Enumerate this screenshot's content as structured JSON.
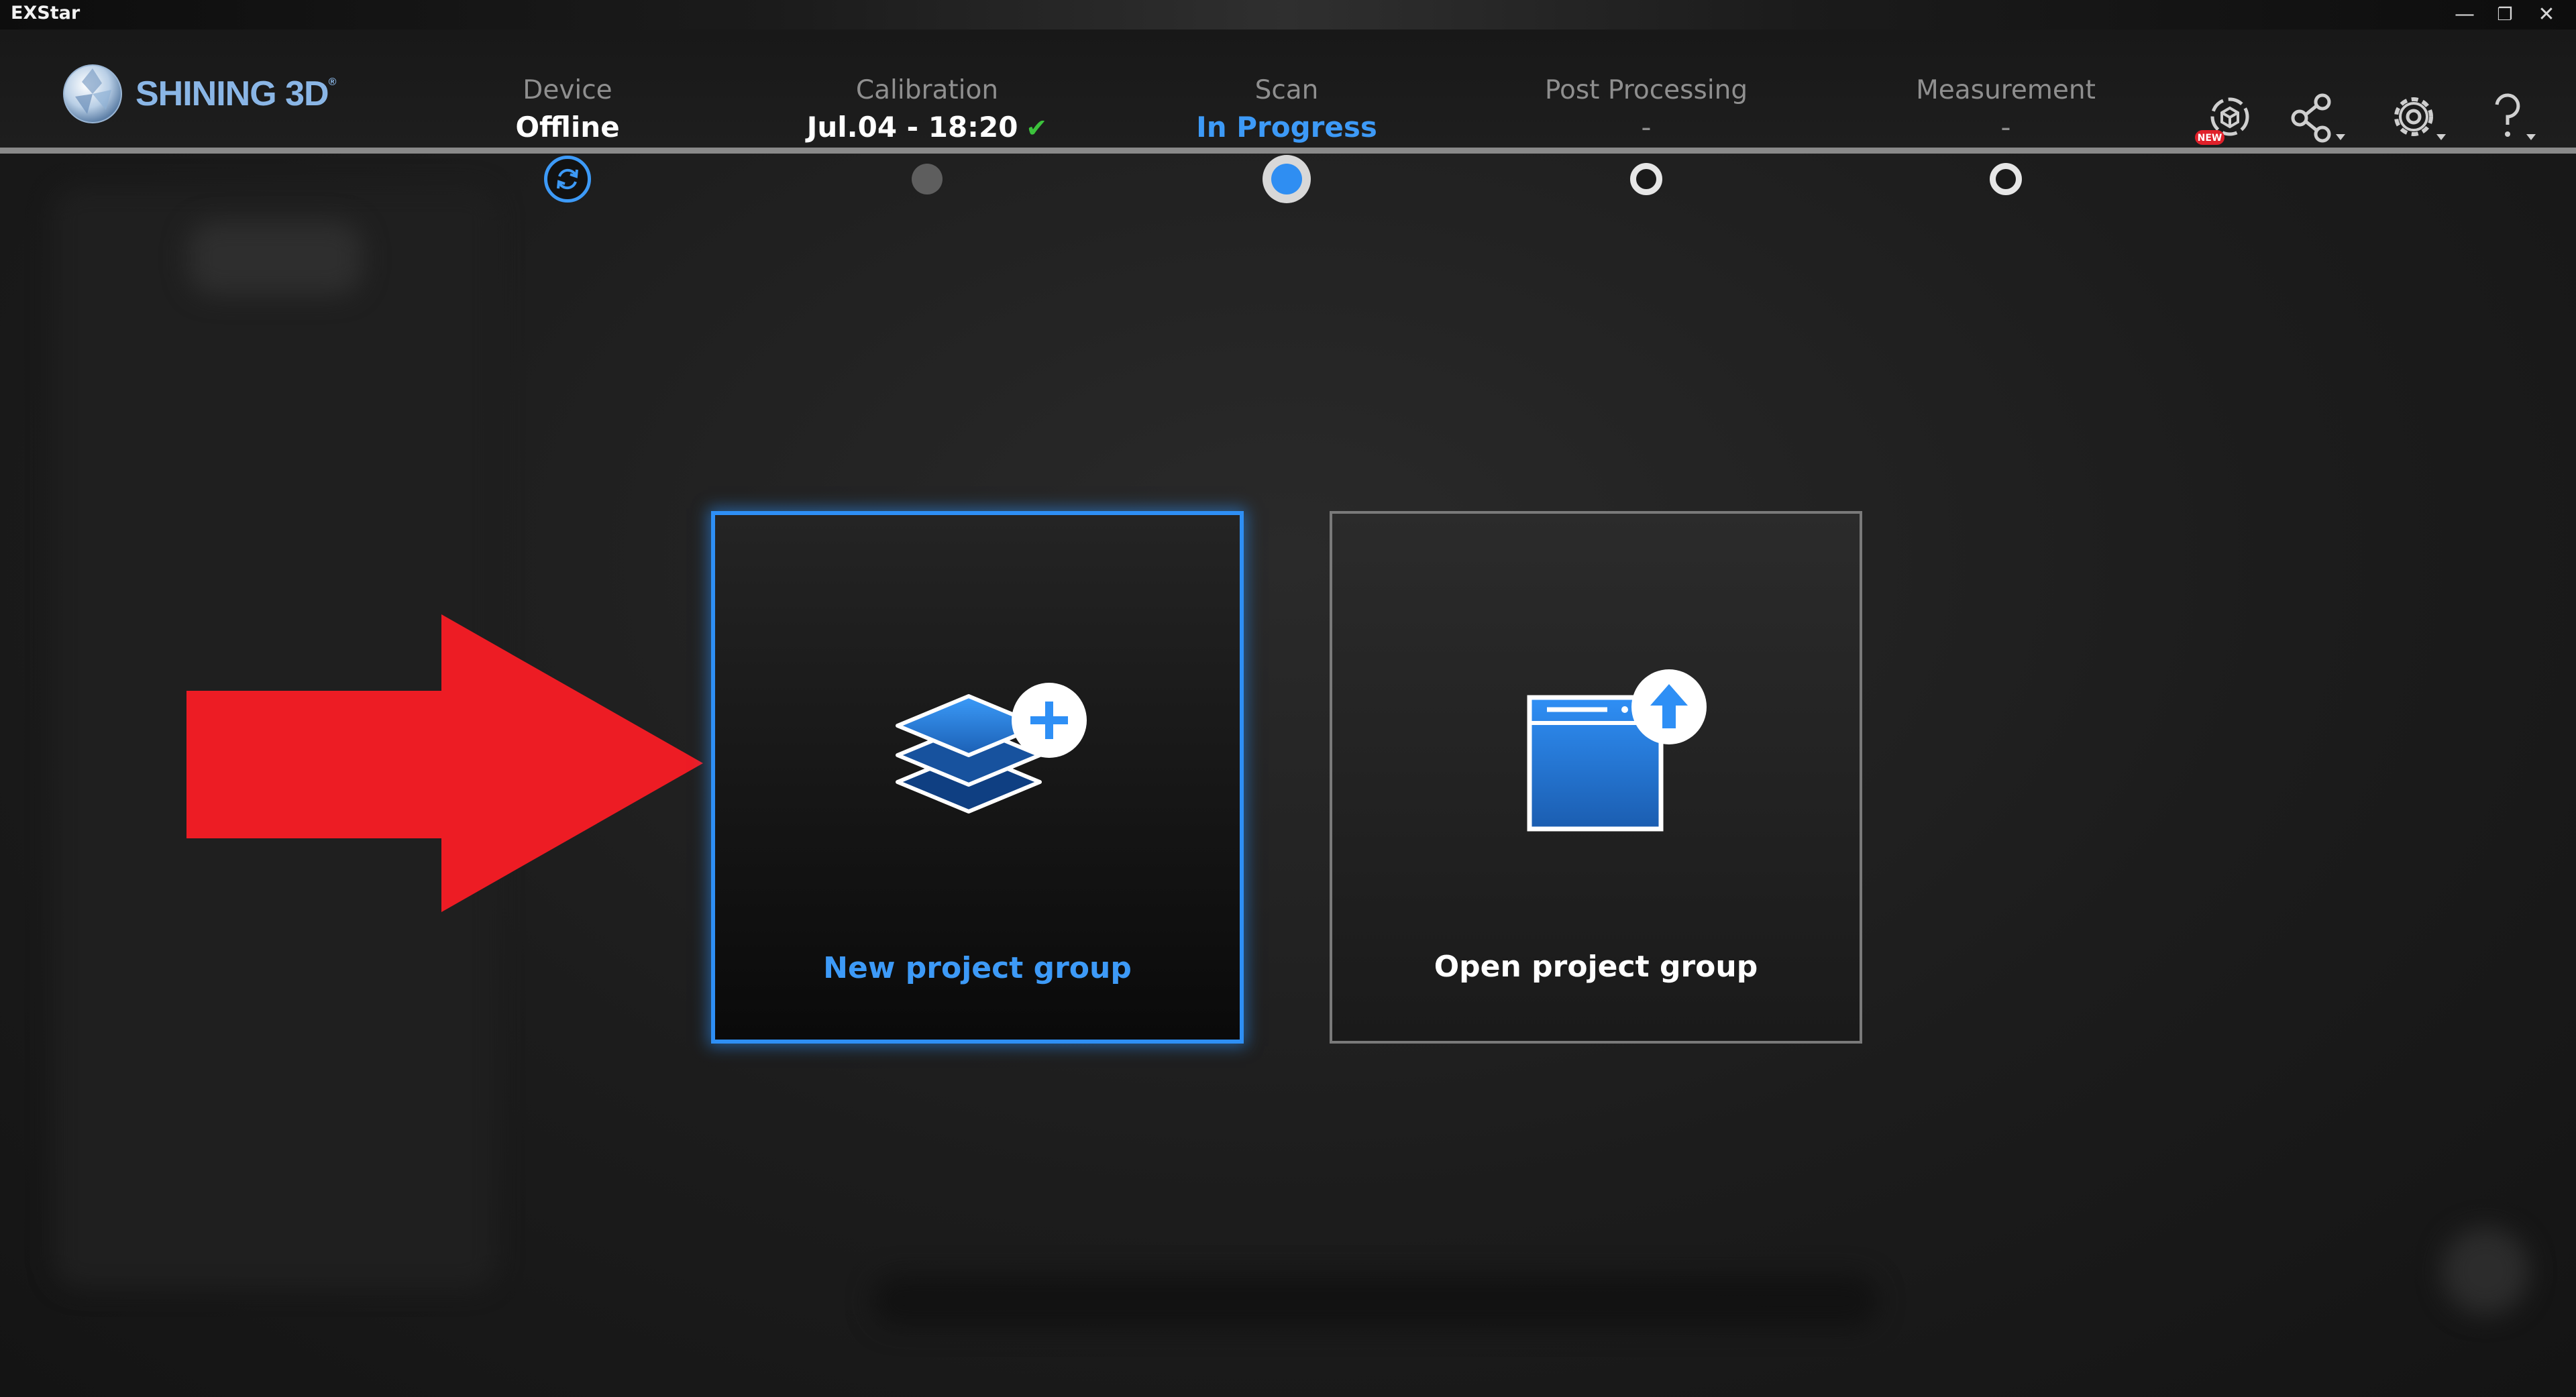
{
  "window": {
    "title": "EXStar",
    "minimize_glyph": "—",
    "restore_glyph": "❐",
    "close_glyph": "✕"
  },
  "brand": {
    "name": "SHINING 3D",
    "registered": "®"
  },
  "steps": [
    {
      "label": "Device",
      "value": "Offline",
      "state": "current-device"
    },
    {
      "label": "Calibration",
      "value": "Jul.04 - 18:20",
      "state": "done"
    },
    {
      "label": "Scan",
      "value": "In Progress",
      "state": "active"
    },
    {
      "label": "Post Processing",
      "value": "-",
      "state": "pending"
    },
    {
      "label": "Measurement",
      "value": "-",
      "state": "pending"
    }
  ],
  "header_icons": [
    "new-feature-icon",
    "share-icon",
    "settings-icon",
    "help-icon"
  ],
  "header_badge": "NEW",
  "cards": {
    "new_label": "New project group",
    "open_label": "Open project group"
  },
  "colors": {
    "accent": "#2e8ff5",
    "check": "#3cc23c",
    "annotation_arrow": "#ed1c24"
  }
}
